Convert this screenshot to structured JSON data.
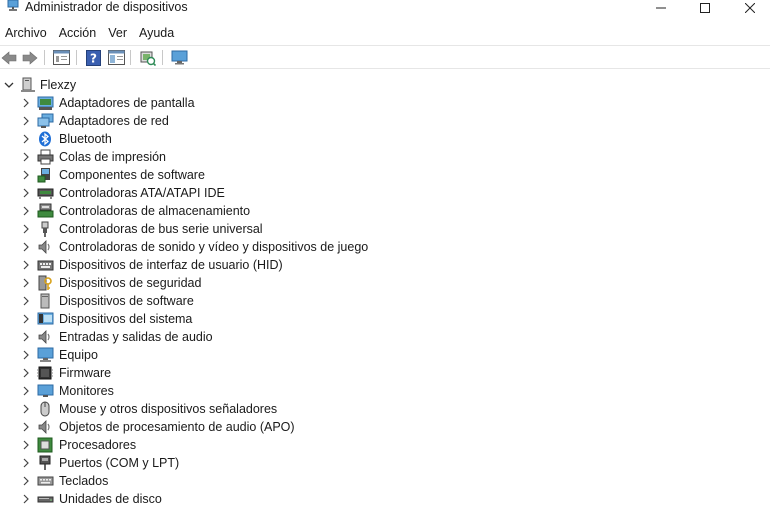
{
  "window": {
    "title": "Administrador de dispositivos"
  },
  "menu": {
    "items": [
      {
        "label": "Archivo"
      },
      {
        "label": "Acción"
      },
      {
        "label": "Ver"
      },
      {
        "label": "Ayuda"
      }
    ]
  },
  "tree": {
    "root": {
      "label": "Flexzy",
      "icon": "computer-tree-icon",
      "expanded": true
    },
    "categories": [
      {
        "label": "Adaptadores de pantalla",
        "icon": "display-adapter-icon"
      },
      {
        "label": "Adaptadores de red",
        "icon": "network-adapter-icon"
      },
      {
        "label": "Bluetooth",
        "icon": "bluetooth-icon"
      },
      {
        "label": "Colas de impresión",
        "icon": "printer-icon"
      },
      {
        "label": "Componentes de software",
        "icon": "software-component-icon"
      },
      {
        "label": "Controladoras ATA/ATAPI IDE",
        "icon": "ide-controller-icon"
      },
      {
        "label": "Controladoras de almacenamiento",
        "icon": "storage-controller-icon"
      },
      {
        "label": "Controladoras de bus serie universal",
        "icon": "usb-icon"
      },
      {
        "label": "Controladoras de sonido y vídeo y dispositivos de juego",
        "icon": "sound-icon"
      },
      {
        "label": "Dispositivos de interfaz de usuario (HID)",
        "icon": "hid-icon"
      },
      {
        "label": "Dispositivos de seguridad",
        "icon": "security-key-icon"
      },
      {
        "label": "Dispositivos de software",
        "icon": "software-device-icon"
      },
      {
        "label": "Dispositivos del sistema",
        "icon": "system-device-icon"
      },
      {
        "label": "Entradas y salidas de audio",
        "icon": "audio-io-icon"
      },
      {
        "label": "Equipo",
        "icon": "computer-icon"
      },
      {
        "label": "Firmware",
        "icon": "firmware-icon"
      },
      {
        "label": "Monitores",
        "icon": "monitor-icon"
      },
      {
        "label": "Mouse y otros dispositivos señaladores",
        "icon": "mouse-icon"
      },
      {
        "label": "Objetos de procesamiento de audio (APO)",
        "icon": "audio-apo-icon"
      },
      {
        "label": "Procesadores",
        "icon": "processor-icon"
      },
      {
        "label": "Puertos (COM y LPT)",
        "icon": "port-icon"
      },
      {
        "label": "Teclados",
        "icon": "keyboard-icon"
      },
      {
        "label": "Unidades de disco",
        "icon": "disk-drive-icon"
      }
    ]
  }
}
